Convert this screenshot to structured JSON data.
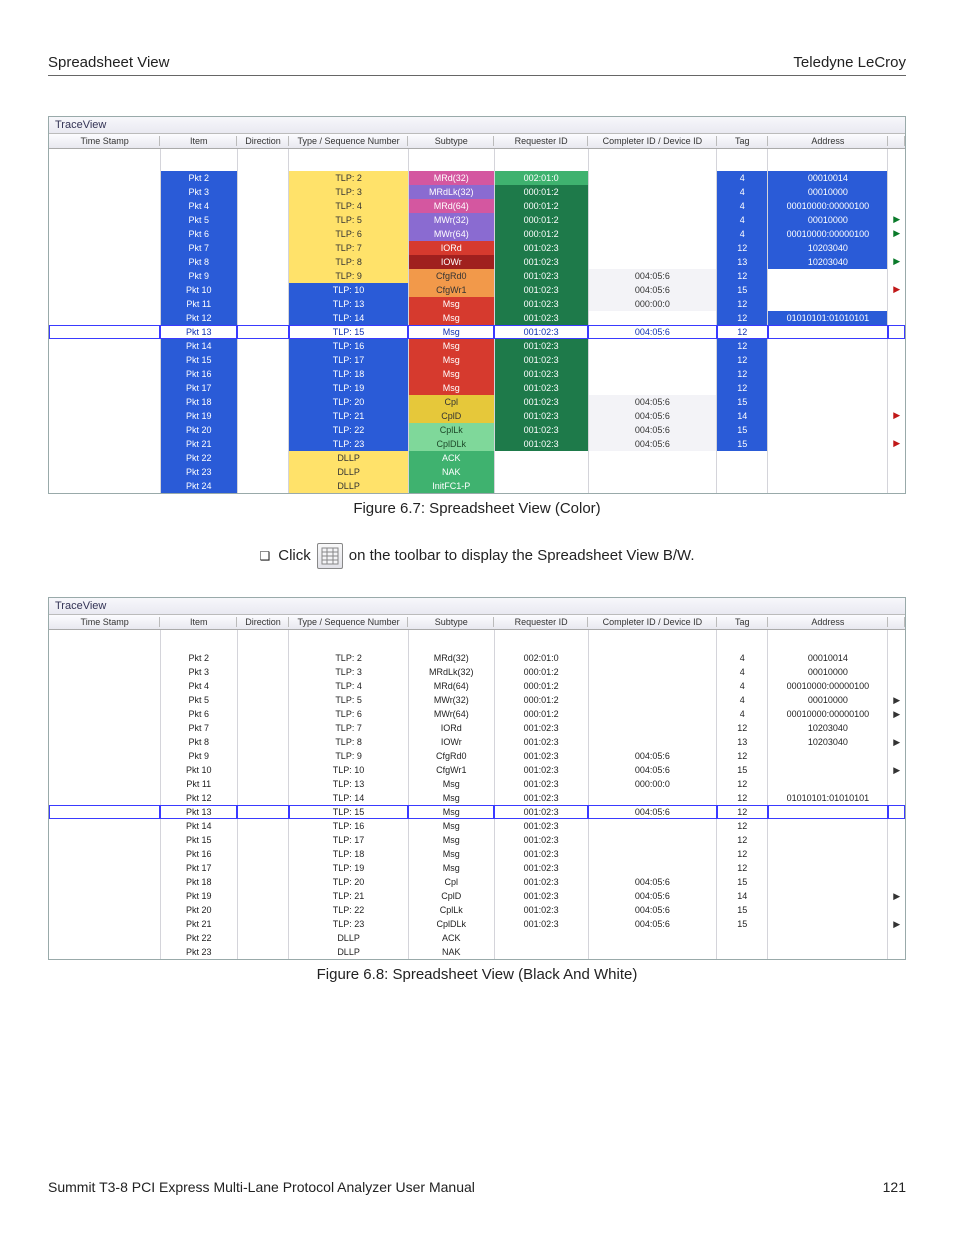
{
  "header": {
    "left": "Spreadsheet View",
    "right": "Teledyne LeCroy"
  },
  "panelTitle": "TraceView",
  "columns": [
    "Time Stamp",
    "Item",
    "Direction",
    "Type / Sequence Number",
    "Subtype",
    "Requester ID",
    "Completer ID / Device ID",
    "Tag",
    "Address",
    ""
  ],
  "caption1": "Figure 6.7:  Spreadsheet View (Color)",
  "instruction": {
    "pre": "Click",
    "post": "on the toolbar to display the Spreadsheet View B/W."
  },
  "caption2": "Figure 6.8:  Spreadsheet View (Black And White)",
  "footer": {
    "left": "Summit T3-8 PCI Express Multi-Lane Protocol Analyzer User Manual",
    "right": "121"
  },
  "colorMap": {
    "blue": {
      "bg": "#2a5bd7",
      "fg": "#ffffff"
    },
    "yellow": {
      "bg": "#ffe26a",
      "fg": "#333333"
    },
    "magenta": {
      "bg": "#d457a0",
      "fg": "#ffffff"
    },
    "violet": {
      "bg": "#8a6bd1",
      "fg": "#ffffff"
    },
    "green": {
      "bg": "#3fb26f",
      "fg": "#ffffff"
    },
    "dgreen": {
      "bg": "#1e7a4a",
      "fg": "#ffffff"
    },
    "lgreen": {
      "bg": "#7fd89a",
      "fg": "#1e4a2a"
    },
    "red": {
      "bg": "#d63a2e",
      "fg": "#ffffff"
    },
    "dred": {
      "bg": "#a0201e",
      "fg": "#ffffff"
    },
    "orange": {
      "bg": "#f2994a",
      "fg": "#333333"
    },
    "gold": {
      "bg": "#e6c83a",
      "fg": "#333333"
    },
    "pale": {
      "bg": "#f3f3f7",
      "fg": "#333333"
    },
    "selbg": {
      "bg": "#ffffff",
      "fg": "#1030b0"
    }
  },
  "rows": [
    {
      "item": "Pkt 2",
      "type": "TLP: 2",
      "sub": "MRd(32)",
      "req": "002:01:0",
      "comp": "",
      "tag": "4",
      "addr": "00010014",
      "arrow": "",
      "c": {
        "item": "blue",
        "type": "yellow",
        "sub": "magenta",
        "req": "green",
        "tag": "blue",
        "addr": "blue"
      }
    },
    {
      "item": "Pkt 3",
      "type": "TLP: 3",
      "sub": "MRdLk(32)",
      "req": "000:01:2",
      "comp": "",
      "tag": "4",
      "addr": "00010000",
      "arrow": "",
      "c": {
        "item": "blue",
        "type": "yellow",
        "sub": "violet",
        "req": "dgreen",
        "tag": "blue",
        "addr": "blue"
      }
    },
    {
      "item": "Pkt 4",
      "type": "TLP: 4",
      "sub": "MRd(64)",
      "req": "000:01:2",
      "comp": "",
      "tag": "4",
      "addr": "00010000:00000100",
      "arrow": "",
      "c": {
        "item": "blue",
        "type": "yellow",
        "sub": "magenta",
        "req": "dgreen",
        "tag": "blue",
        "addr": "blue"
      }
    },
    {
      "item": "Pkt 5",
      "type": "TLP: 5",
      "sub": "MWr(32)",
      "req": "000:01:2",
      "comp": "",
      "tag": "4",
      "addr": "00010000",
      "arrow": "tri",
      "c": {
        "item": "blue",
        "type": "yellow",
        "sub": "violet",
        "req": "dgreen",
        "tag": "blue",
        "addr": "blue"
      }
    },
    {
      "item": "Pkt 6",
      "type": "TLP: 6",
      "sub": "MWr(64)",
      "req": "000:01:2",
      "comp": "",
      "tag": "4",
      "addr": "00010000:00000100",
      "arrow": "tri",
      "c": {
        "item": "blue",
        "type": "yellow",
        "sub": "violet",
        "req": "dgreen",
        "tag": "blue",
        "addr": "blue"
      }
    },
    {
      "item": "Pkt 7",
      "type": "TLP: 7",
      "sub": "IORd",
      "req": "001:02:3",
      "comp": "",
      "tag": "12",
      "addr": "10203040",
      "arrow": "",
      "c": {
        "item": "blue",
        "type": "yellow",
        "sub": "red",
        "req": "dgreen",
        "tag": "blue",
        "addr": "blue"
      }
    },
    {
      "item": "Pkt 8",
      "type": "TLP: 8",
      "sub": "IOWr",
      "req": "001:02:3",
      "comp": "",
      "tag": "13",
      "addr": "10203040",
      "arrow": "tri",
      "c": {
        "item": "blue",
        "type": "yellow",
        "sub": "dred",
        "req": "dgreen",
        "tag": "blue",
        "addr": "blue"
      }
    },
    {
      "item": "Pkt 9",
      "type": "TLP: 9",
      "sub": "CfgRd0",
      "req": "001:02:3",
      "comp": "004:05:6",
      "tag": "12",
      "addr": "",
      "arrow": "",
      "c": {
        "item": "blue",
        "type": "yellow",
        "sub": "orange",
        "req": "dgreen",
        "comp": "pale",
        "tag": "blue"
      }
    },
    {
      "item": "Pkt 10",
      "type": "TLP: 10",
      "sub": "CfgWr1",
      "req": "001:02:3",
      "comp": "004:05:6",
      "tag": "15",
      "addr": "",
      "arrow": "tri-red",
      "c": {
        "item": "blue",
        "type": "blue",
        "sub": "orange",
        "req": "dgreen",
        "comp": "pale",
        "tag": "blue"
      }
    },
    {
      "item": "Pkt 11",
      "type": "TLP: 13",
      "sub": "Msg",
      "req": "001:02:3",
      "comp": "000:00:0",
      "tag": "12",
      "addr": "",
      "arrow": "",
      "c": {
        "item": "blue",
        "type": "blue",
        "sub": "red",
        "req": "dgreen",
        "comp": "pale",
        "tag": "blue"
      }
    },
    {
      "item": "Pkt 12",
      "type": "TLP: 14",
      "sub": "Msg",
      "req": "001:02:3",
      "comp": "",
      "tag": "12",
      "addr": "01010101:01010101",
      "arrow": "",
      "c": {
        "item": "blue",
        "type": "blue",
        "sub": "red",
        "req": "dgreen",
        "tag": "blue",
        "addr": "blue"
      }
    },
    {
      "sel": true,
      "item": "Pkt 13",
      "type": "TLP: 15",
      "sub": "Msg",
      "req": "001:02:3",
      "comp": "004:05:6",
      "tag": "12",
      "addr": "",
      "arrow": "",
      "c": {
        "item": "selbg",
        "type": "selbg",
        "sub": "selbg",
        "req": "selbg",
        "comp": "selbg",
        "tag": "selbg"
      }
    },
    {
      "item": "Pkt 14",
      "type": "TLP: 16",
      "sub": "Msg",
      "req": "001:02:3",
      "comp": "",
      "tag": "12",
      "addr": "",
      "arrow": "",
      "c": {
        "item": "blue",
        "type": "blue",
        "sub": "red",
        "req": "dgreen",
        "tag": "blue"
      }
    },
    {
      "item": "Pkt 15",
      "type": "TLP: 17",
      "sub": "Msg",
      "req": "001:02:3",
      "comp": "",
      "tag": "12",
      "addr": "",
      "arrow": "",
      "c": {
        "item": "blue",
        "type": "blue",
        "sub": "red",
        "req": "dgreen",
        "tag": "blue"
      }
    },
    {
      "item": "Pkt 16",
      "type": "TLP: 18",
      "sub": "Msg",
      "req": "001:02:3",
      "comp": "",
      "tag": "12",
      "addr": "",
      "arrow": "",
      "c": {
        "item": "blue",
        "type": "blue",
        "sub": "red",
        "req": "dgreen",
        "tag": "blue"
      }
    },
    {
      "item": "Pkt 17",
      "type": "TLP: 19",
      "sub": "Msg",
      "req": "001:02:3",
      "comp": "",
      "tag": "12",
      "addr": "",
      "arrow": "",
      "c": {
        "item": "blue",
        "type": "blue",
        "sub": "red",
        "req": "dgreen",
        "tag": "blue"
      }
    },
    {
      "item": "Pkt 18",
      "type": "TLP: 20",
      "sub": "Cpl",
      "req": "001:02:3",
      "comp": "004:05:6",
      "tag": "15",
      "addr": "",
      "arrow": "",
      "c": {
        "item": "blue",
        "type": "blue",
        "sub": "gold",
        "req": "dgreen",
        "comp": "pale",
        "tag": "blue"
      }
    },
    {
      "item": "Pkt 19",
      "type": "TLP: 21",
      "sub": "CplD",
      "req": "001:02:3",
      "comp": "004:05:6",
      "tag": "14",
      "addr": "",
      "arrow": "tri-red",
      "c": {
        "item": "blue",
        "type": "blue",
        "sub": "gold",
        "req": "dgreen",
        "comp": "pale",
        "tag": "blue"
      }
    },
    {
      "item": "Pkt 20",
      "type": "TLP: 22",
      "sub": "CplLk",
      "req": "001:02:3",
      "comp": "004:05:6",
      "tag": "15",
      "addr": "",
      "arrow": "",
      "c": {
        "item": "blue",
        "type": "blue",
        "sub": "lgreen",
        "req": "dgreen",
        "comp": "pale",
        "tag": "blue"
      }
    },
    {
      "item": "Pkt 21",
      "type": "TLP: 23",
      "sub": "CplDLk",
      "req": "001:02:3",
      "comp": "004:05:6",
      "tag": "15",
      "addr": "",
      "arrow": "tri-red",
      "c": {
        "item": "blue",
        "type": "blue",
        "sub": "lgreen",
        "req": "dgreen",
        "comp": "pale",
        "tag": "blue"
      }
    },
    {
      "item": "Pkt 22",
      "type": "DLLP",
      "sub": "ACK",
      "req": "",
      "comp": "",
      "tag": "",
      "addr": "",
      "arrow": "",
      "c": {
        "item": "blue",
        "type": "yellow",
        "sub": "green"
      }
    },
    {
      "item": "Pkt 23",
      "type": "DLLP",
      "sub": "NAK",
      "req": "",
      "comp": "",
      "tag": "",
      "addr": "",
      "arrow": "",
      "c": {
        "item": "blue",
        "type": "yellow",
        "sub": "green"
      }
    },
    {
      "item": "Pkt 24",
      "type": "DLLP",
      "sub": "InitFC1-P",
      "req": "",
      "comp": "",
      "tag": "",
      "addr": "",
      "arrow": "",
      "c": {
        "item": "blue",
        "type": "yellow",
        "sub": "green"
      }
    }
  ],
  "rowsBW": [
    {
      "item": "Pkt 2",
      "type": "TLP: 2",
      "sub": "MRd(32)",
      "req": "002:01:0",
      "comp": "",
      "tag": "4",
      "addr": "00010014",
      "arrow": ""
    },
    {
      "item": "Pkt 3",
      "type": "TLP: 3",
      "sub": "MRdLk(32)",
      "req": "000:01:2",
      "comp": "",
      "tag": "4",
      "addr": "00010000",
      "arrow": ""
    },
    {
      "item": "Pkt 4",
      "type": "TLP: 4",
      "sub": "MRd(64)",
      "req": "000:01:2",
      "comp": "",
      "tag": "4",
      "addr": "00010000:00000100",
      "arrow": ""
    },
    {
      "item": "Pkt 5",
      "type": "TLP: 5",
      "sub": "MWr(32)",
      "req": "000:01:2",
      "comp": "",
      "tag": "4",
      "addr": "00010000",
      "arrow": "line"
    },
    {
      "item": "Pkt 6",
      "type": "TLP: 6",
      "sub": "MWr(64)",
      "req": "000:01:2",
      "comp": "",
      "tag": "4",
      "addr": "00010000:00000100",
      "arrow": "line"
    },
    {
      "item": "Pkt 7",
      "type": "TLP: 7",
      "sub": "IORd",
      "req": "001:02:3",
      "comp": "",
      "tag": "12",
      "addr": "10203040",
      "arrow": ""
    },
    {
      "item": "Pkt 8",
      "type": "TLP: 8",
      "sub": "IOWr",
      "req": "001:02:3",
      "comp": "",
      "tag": "13",
      "addr": "10203040",
      "arrow": "line"
    },
    {
      "item": "Pkt 9",
      "type": "TLP: 9",
      "sub": "CfgRd0",
      "req": "001:02:3",
      "comp": "004:05:6",
      "tag": "12",
      "addr": "",
      "arrow": ""
    },
    {
      "item": "Pkt 10",
      "type": "TLP: 10",
      "sub": "CfgWr1",
      "req": "001:02:3",
      "comp": "004:05:6",
      "tag": "15",
      "addr": "",
      "arrow": "line"
    },
    {
      "item": "Pkt 11",
      "type": "TLP: 13",
      "sub": "Msg",
      "req": "001:02:3",
      "comp": "000:00:0",
      "tag": "12",
      "addr": "",
      "arrow": ""
    },
    {
      "item": "Pkt 12",
      "type": "TLP: 14",
      "sub": "Msg",
      "req": "001:02:3",
      "comp": "",
      "tag": "12",
      "addr": "01010101:01010101",
      "arrow": ""
    },
    {
      "sel": true,
      "item": "Pkt 13",
      "type": "TLP: 15",
      "sub": "Msg",
      "req": "001:02:3",
      "comp": "004:05:6",
      "tag": "12",
      "addr": "",
      "arrow": ""
    },
    {
      "item": "Pkt 14",
      "type": "TLP: 16",
      "sub": "Msg",
      "req": "001:02:3",
      "comp": "",
      "tag": "12",
      "addr": "",
      "arrow": ""
    },
    {
      "item": "Pkt 15",
      "type": "TLP: 17",
      "sub": "Msg",
      "req": "001:02:3",
      "comp": "",
      "tag": "12",
      "addr": "",
      "arrow": ""
    },
    {
      "item": "Pkt 16",
      "type": "TLP: 18",
      "sub": "Msg",
      "req": "001:02:3",
      "comp": "",
      "tag": "12",
      "addr": "",
      "arrow": ""
    },
    {
      "item": "Pkt 17",
      "type": "TLP: 19",
      "sub": "Msg",
      "req": "001:02:3",
      "comp": "",
      "tag": "12",
      "addr": "",
      "arrow": ""
    },
    {
      "item": "Pkt 18",
      "type": "TLP: 20",
      "sub": "Cpl",
      "req": "001:02:3",
      "comp": "004:05:6",
      "tag": "15",
      "addr": "",
      "arrow": ""
    },
    {
      "item": "Pkt 19",
      "type": "TLP: 21",
      "sub": "CplD",
      "req": "001:02:3",
      "comp": "004:05:6",
      "tag": "14",
      "addr": "",
      "arrow": "line"
    },
    {
      "item": "Pkt 20",
      "type": "TLP: 22",
      "sub": "CplLk",
      "req": "001:02:3",
      "comp": "004:05:6",
      "tag": "15",
      "addr": "",
      "arrow": ""
    },
    {
      "item": "Pkt 21",
      "type": "TLP: 23",
      "sub": "CplDLk",
      "req": "001:02:3",
      "comp": "004:05:6",
      "tag": "15",
      "addr": "",
      "arrow": "line"
    },
    {
      "item": "Pkt 22",
      "type": "DLLP",
      "sub": "ACK",
      "req": "",
      "comp": "",
      "tag": "",
      "addr": "",
      "arrow": ""
    },
    {
      "item": "Pkt 23",
      "type": "DLLP",
      "sub": "NAK",
      "req": "",
      "comp": "",
      "tag": "",
      "addr": "",
      "arrow": ""
    }
  ]
}
